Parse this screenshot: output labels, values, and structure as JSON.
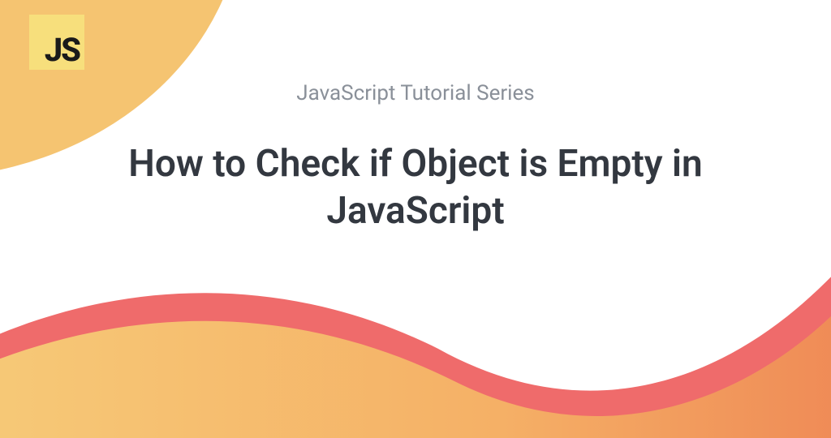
{
  "logo": {
    "text": "JS"
  },
  "subtitle": "JavaScript Tutorial Series",
  "title": "How to Check if Object is Empty in JavaScript",
  "colors": {
    "blob_yellow": "#f5c471",
    "logo_yellow": "#f7df7c",
    "wave_coral": "#ef6b6b",
    "wave_orange_light": "#f6c36f",
    "wave_orange_dark": "#f08a4b",
    "subtitle_gray": "#8a9099",
    "title_dark": "#333840"
  }
}
